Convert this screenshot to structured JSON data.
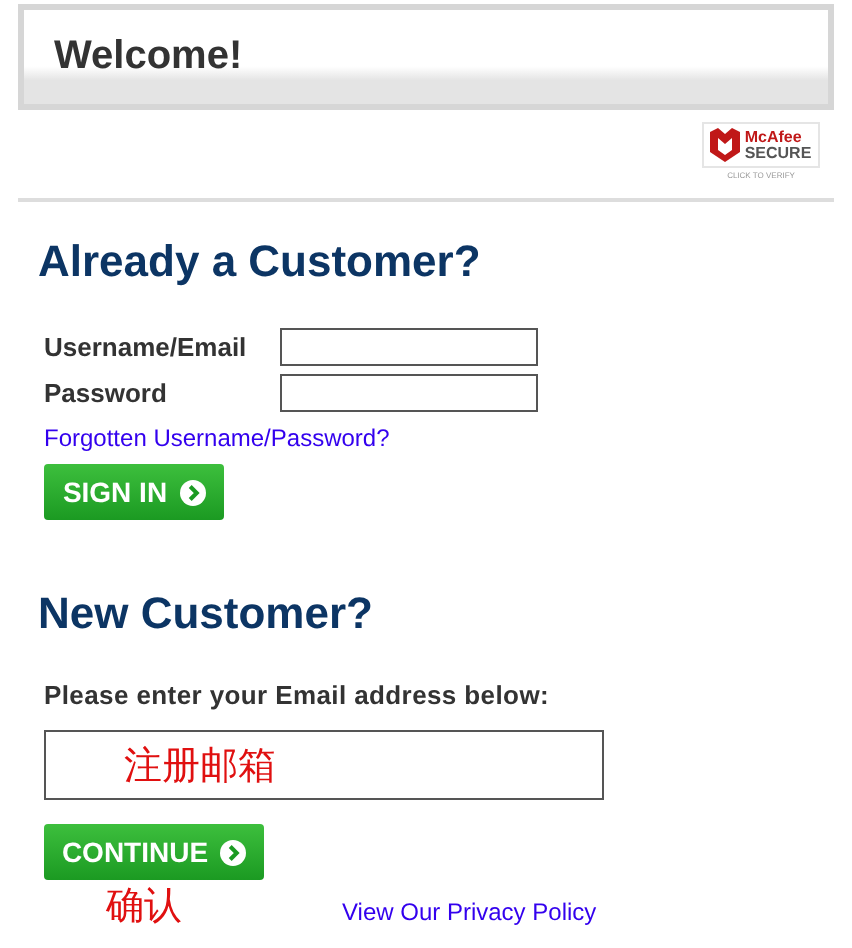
{
  "header": {
    "title": "Welcome!"
  },
  "badge": {
    "brand": "McAfee",
    "label": "SECURE",
    "caption": "CLICK TO VERIFY"
  },
  "login": {
    "heading": "Already a Customer?",
    "fields": [
      {
        "label": "Username/Email"
      },
      {
        "label": "Password"
      }
    ],
    "forgot_link": "Forgotten Username/Password?",
    "button": "SIGN IN"
  },
  "register": {
    "heading": "New Customer?",
    "prompt": "Please enter your Email address below:",
    "email_value": "注册邮箱",
    "button": "CONTINUE",
    "button_note": "确认",
    "privacy_link": "View Our Privacy Policy"
  }
}
